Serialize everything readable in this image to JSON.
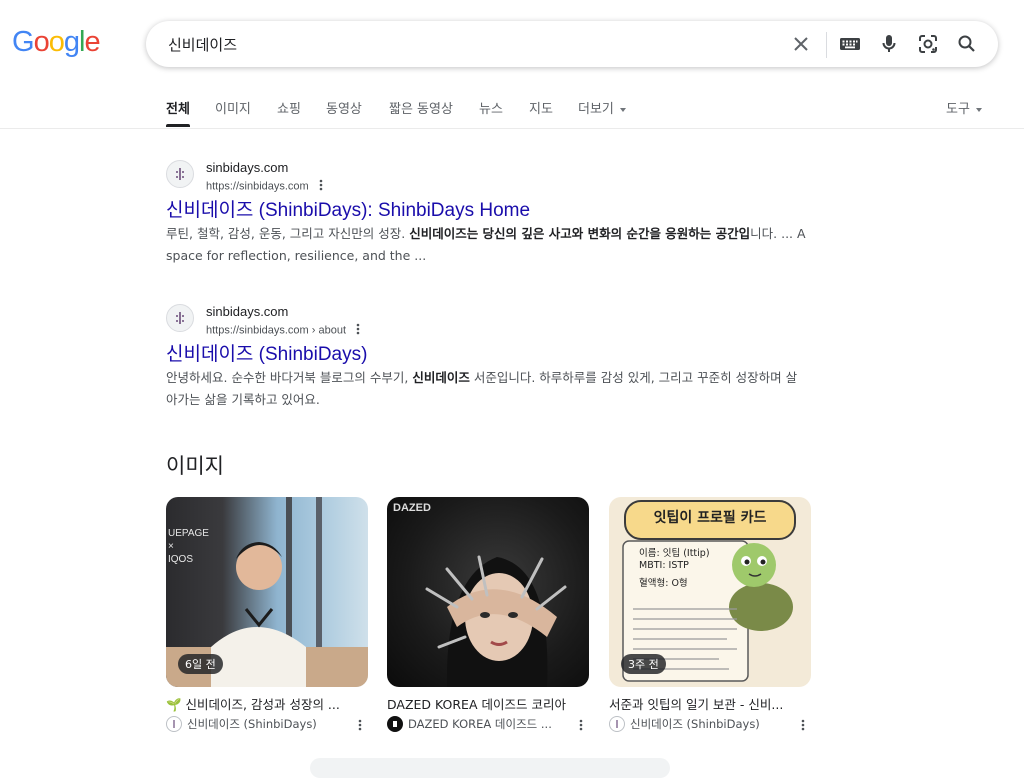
{
  "logo": {
    "letters": [
      "G",
      "o",
      "o",
      "g",
      "l",
      "e"
    ],
    "colors": [
      "#4285F4",
      "#EA4335",
      "#FBBC05",
      "#4285F4",
      "#34A853",
      "#EA4335"
    ]
  },
  "search": {
    "query": "신비데이즈"
  },
  "tabs": [
    "전체",
    "이미지",
    "쇼핑",
    "동영상",
    "짧은 동영상",
    "뉴스",
    "지도",
    "더보기"
  ],
  "tools_label": "도구",
  "results": [
    {
      "site": "sinbidays.com",
      "url": "https://sinbidays.com",
      "title": "신비데이즈 (ShinbiDays): ShinbiDays Home",
      "snippet_pre": "루틴, 철학, 감성, 운동, 그리고 자신만의 성장. ",
      "snippet_bold": "신비데이즈는 당신의 깊은 사고와 변화의 순간을 응원하는 공간입",
      "snippet_post": "니다. ... A space for reflection, resilience, and the ..."
    },
    {
      "site": "sinbidays.com",
      "url": "https://sinbidays.com › about",
      "title": "신비데이즈 (ShinbiDays)",
      "snippet_pre": "안녕하세요. 순수한 바다거북 블로그의 수부기, ",
      "snippet_bold": "신비데이즈",
      "snippet_post": " 서준입니다. 하루하루를 감성 있게, 그리고 꾸준히 성장하며 살아가는 삶을 기록하고 있어요."
    }
  ],
  "images_section": {
    "title": "이미지",
    "cards": [
      {
        "age": "6일 전",
        "title": "🌱 신비데이즈, 감성과 성장의 ...",
        "source": "신비데이즈 (ShinbiDays)",
        "thumb_text": "UEPAGE\n×\nIQOS"
      },
      {
        "age": "",
        "title": "DAZED KOREA 데이즈드 코리아",
        "source": "DAZED KOREA 데이즈드 ...",
        "thumb_text": "DAZED"
      },
      {
        "age": "3주 전",
        "title": "서준과 잇팁의 일기 보관 - 신비...",
        "source": "신비데이즈 (ShinbiDays)",
        "thumb_text": "잇팁이 프로필 카드",
        "profile_lines": [
          "이름: 잇팁 (Ittip)",
          "MBTI: ISTP",
          "혈액형: O형"
        ]
      }
    ]
  }
}
